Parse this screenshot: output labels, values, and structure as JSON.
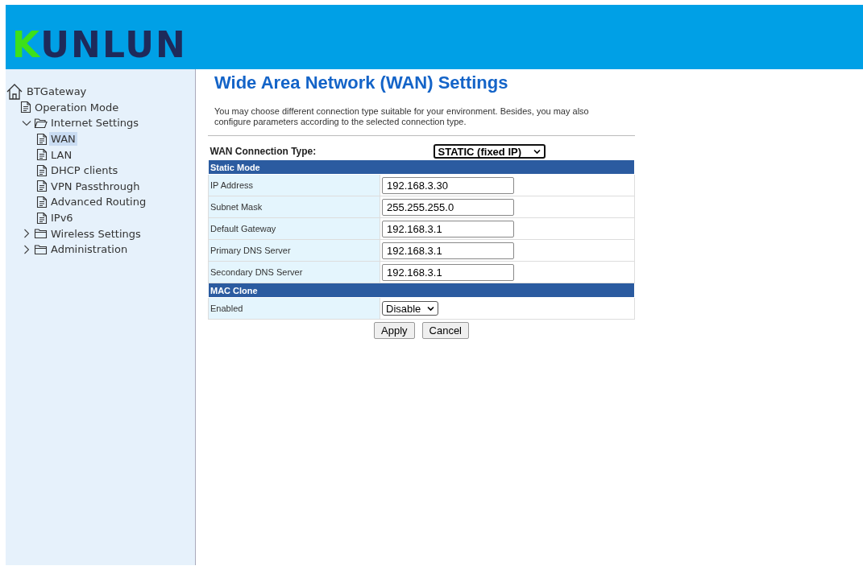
{
  "header": {
    "logo": "KUNLUN"
  },
  "sidebar": {
    "tree": [
      {
        "label": "BTGateway",
        "kind": "home",
        "children": [
          {
            "label": "Operation Mode",
            "kind": "page",
            "selected": false
          },
          {
            "label": "Internet Settings",
            "kind": "folder",
            "expanded": true,
            "children": [
              {
                "label": "WAN",
                "kind": "page",
                "selected": true
              },
              {
                "label": "LAN",
                "kind": "page",
                "selected": false
              },
              {
                "label": "DHCP clients",
                "kind": "page",
                "selected": false
              },
              {
                "label": "VPN Passthrough",
                "kind": "page",
                "selected": false
              },
              {
                "label": "Advanced Routing",
                "kind": "page",
                "selected": false
              },
              {
                "label": "IPv6",
                "kind": "page",
                "selected": false
              }
            ]
          },
          {
            "label": "Wireless Settings",
            "kind": "folder",
            "expanded": false
          },
          {
            "label": "Administration",
            "kind": "folder",
            "expanded": false
          }
        ]
      }
    ]
  },
  "main": {
    "title": "Wide Area Network (WAN) Settings",
    "description": "You may choose different connection type suitable for your environment. Besides, you may also configure parameters according to the selected connection type.",
    "connection_type": {
      "label": "WAN Connection Type:",
      "value": "STATIC (fixed IP)"
    },
    "sections": [
      {
        "heading": "Static Mode",
        "rows": [
          {
            "label": "IP Address",
            "kind": "text",
            "value": "192.168.3.30"
          },
          {
            "label": "Subnet Mask",
            "kind": "text",
            "value": "255.255.255.0"
          },
          {
            "label": "Default Gateway",
            "kind": "text",
            "value": "192.168.3.1"
          },
          {
            "label": "Primary DNS Server",
            "kind": "text",
            "value": "192.168.3.1"
          },
          {
            "label": "Secondary DNS Server",
            "kind": "text",
            "value": "192.168.3.1"
          }
        ]
      },
      {
        "heading": "MAC Clone",
        "rows": [
          {
            "label": "Enabled",
            "kind": "select",
            "value": "Disable"
          }
        ]
      }
    ],
    "buttons": [
      "Apply",
      "Cancel"
    ]
  }
}
